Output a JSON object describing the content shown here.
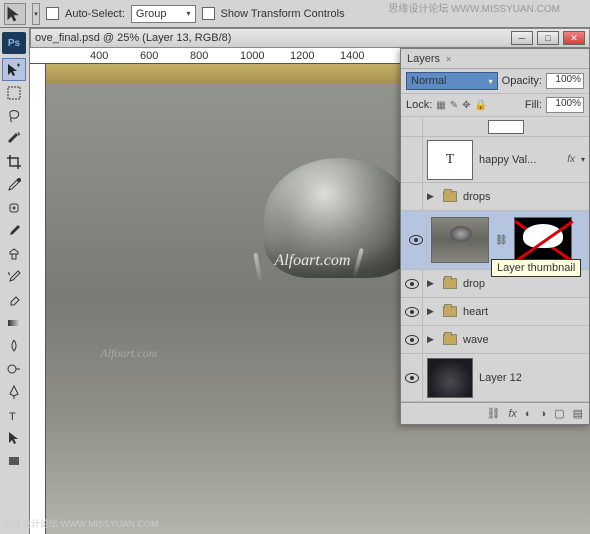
{
  "options_bar": {
    "auto_select_label": "Auto-Select:",
    "group_label": "Group",
    "show_transform_label": "Show Transform Controls"
  },
  "watermarks": {
    "top": "思缘设计论坛 WWW.MISSYUAN.COM",
    "bottom": "思缘设计论坛 WWW.MISSYUAN.COM",
    "canvas1": "Alfoart.com",
    "canvas2": "Alfoart.com"
  },
  "document": {
    "title": "ove_final.psd @ 25% (Layer 13, RGB/8)"
  },
  "ruler": {
    "t1": "400",
    "t2": "600",
    "t3": "800",
    "t4": "1000",
    "t5": "1200",
    "t6": "1400"
  },
  "layers_panel": {
    "tab_label": "Layers",
    "blend_mode": "Normal",
    "opacity_label": "Opacity:",
    "opacity_value": "100%",
    "lock_label": "Lock:",
    "fill_label": "Fill:",
    "fill_value": "100%",
    "tooltip": "Layer thumbnail",
    "fx_label": "fx",
    "layers": {
      "text_layer": "happy Val...",
      "group_drops": "drops",
      "group_drop": "drop",
      "group_heart": "heart",
      "group_wave": "wave",
      "layer12": "Layer 12"
    }
  }
}
